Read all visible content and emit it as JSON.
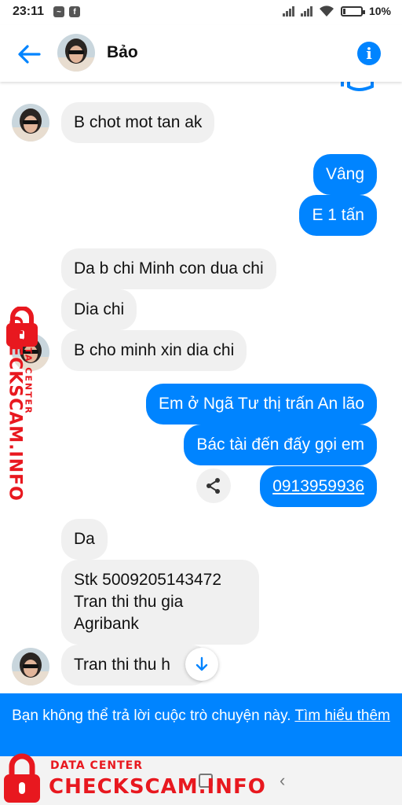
{
  "status_bar": {
    "time": "23:11",
    "battery": "10%"
  },
  "header": {
    "contact_name": "Bảo"
  },
  "messages": [
    {
      "from": "them",
      "text": "B chot mot tan ak"
    },
    {
      "from": "me",
      "text": "Vâng"
    },
    {
      "from": "me",
      "text": "E 1 tấn"
    },
    {
      "from": "them",
      "text": "Da b chi Minh con dua chi"
    },
    {
      "from": "them",
      "text": "Dia chi"
    },
    {
      "from": "them",
      "text": "B cho minh xin dia chi"
    },
    {
      "from": "me",
      "text": "Em ở Ngã Tư thị trấn An lão"
    },
    {
      "from": "me",
      "text": "Bác tài đến đấy gọi em"
    },
    {
      "from": "me",
      "text": "0913959936"
    },
    {
      "from": "them",
      "text": "Da"
    },
    {
      "from": "them",
      "text": "Stk 5009205143472\nTran thi thu gia\nAgribank"
    },
    {
      "from": "them",
      "text": "Tran thi thu h"
    }
  ],
  "banner": {
    "text": "Bạn không thể trả lời cuộc trò chuyện này.",
    "link": "Tìm hiểu thêm"
  },
  "watermark": {
    "brand": "CHECKSCAM.INFO",
    "tagline": "DATA CENTER",
    "color": "#e8181f"
  },
  "colors": {
    "accent": "#0084ff",
    "incoming_bubble": "#f0f0f0"
  }
}
